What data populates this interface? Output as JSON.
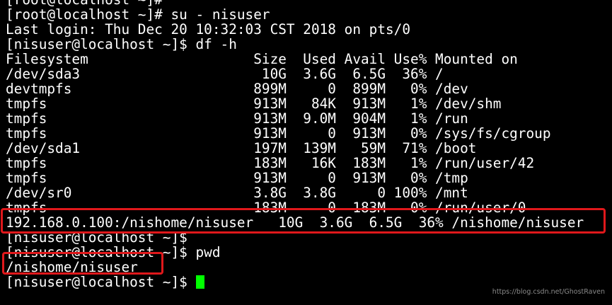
{
  "terminal": {
    "lines": [
      "[root@localhost ~]#",
      "[root@localhost ~]# su - nisuser",
      "Last login: Thu Dec 20 10:32:03 CST 2018 on pts/0",
      "[nisuser@localhost ~]$ df -h",
      "Filesystem                    Size  Used Avail Use% Mounted on",
      "/dev/sda3                      10G  3.6G  6.5G  36% /",
      "devtmpfs                      899M     0  899M   0% /dev",
      "tmpfs                         913M   84K  913M   1% /dev/shm",
      "tmpfs                         913M  9.0M  904M   1% /run",
      "tmpfs                         913M     0  913M   0% /sys/fs/cgroup",
      "/dev/sda1                     197M  139M   59M  71% /boot",
      "tmpfs                         183M   16K  183M   1% /run/user/42",
      "tmpfs                         913M     0  913M   0% /tmp",
      "/dev/sr0                      3.8G  3.8G     0 100% /mnt",
      "tmpfs                         183M     0  183M   0% /run/user/0",
      "192.168.0.100:/nishome/nisuser   10G  3.6G  6.5G  36% /nishome/nisuser",
      "[nisuser@localhost ~]$",
      "[nisuser@localhost ~]$ pwd",
      "/nishome/nisuser",
      "[nisuser@localhost ~]$ "
    ]
  },
  "colors": {
    "background": "#000000",
    "text": "#ffffff",
    "cursor": "#00ff00",
    "highlight": "#e0181b"
  },
  "watermark": "https://blog.csdn.net/GhostRaven"
}
